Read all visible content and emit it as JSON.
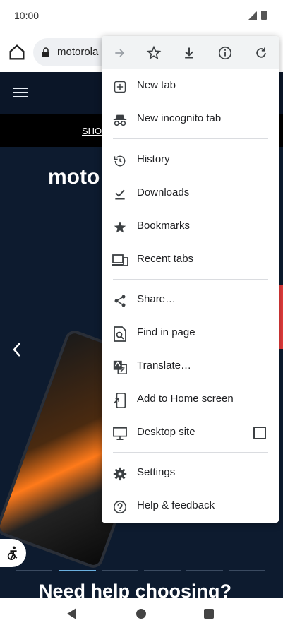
{
  "status": {
    "time": "10:00"
  },
  "browser": {
    "url": "motorola"
  },
  "site": {
    "promo": "SHO",
    "brand": "moto",
    "cta": "Need help choosing?"
  },
  "menu": {
    "toolbar": [
      "forward-icon",
      "bookmark-star-icon",
      "download-icon",
      "info-icon",
      "refresh-icon"
    ],
    "items": {
      "new_tab": "New tab",
      "incognito": "New incognito tab",
      "history": "History",
      "downloads": "Downloads",
      "bookmarks": "Bookmarks",
      "recent_tabs": "Recent tabs",
      "share": "Share…",
      "find": "Find in page",
      "translate": "Translate…",
      "add_home": "Add to Home screen",
      "desktop": "Desktop site",
      "settings": "Settings",
      "help": "Help & feedback"
    },
    "desktop_site_checked": false
  },
  "colors": {
    "menu_bg": "#ffffff",
    "menu_toolbar_bg": "#f1f3f4",
    "site_bg": "#0d1b2f",
    "accent_red": "#e33b3b"
  }
}
